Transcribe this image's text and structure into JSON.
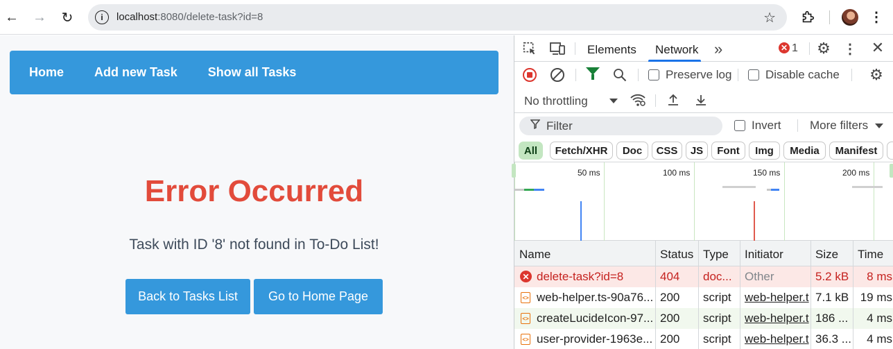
{
  "browser": {
    "url_host": "localhost",
    "url_rest": ":8080/delete-task?id=8",
    "icons": {
      "back": "back-arrow-icon",
      "forward": "forward-arrow-icon",
      "reload": "reload-icon",
      "info": "site-info-icon",
      "bookmark": "star-icon",
      "extensions": "puzzle-icon",
      "menu": "kebab-menu-icon"
    }
  },
  "page": {
    "nav": [
      "Home",
      "Add new Task",
      "Show all Tasks"
    ],
    "error_title": "Error Occurred",
    "error_message": "Task with ID '8' not found in To-Do List!",
    "buttons": {
      "back": "Back to Tasks List",
      "home": "Go to Home Page"
    },
    "colors": {
      "brand": "#3598dc",
      "error": "#e24b3b"
    }
  },
  "devtools": {
    "tabs": [
      "Elements",
      "Network"
    ],
    "active_tab": "Network",
    "more_tabs": "»",
    "error_count": "1",
    "preserve_log": "Preserve log",
    "disable_cache": "Disable cache",
    "throttling": "No throttling",
    "filter_placeholder": "Filter",
    "invert": "Invert",
    "more_filters": "More filters",
    "type_filters": [
      "All",
      "Fetch/XHR",
      "Doc",
      "CSS",
      "JS",
      "Font",
      "Img",
      "Media",
      "Manifest"
    ],
    "active_type_filter": "All",
    "timeline_labels": [
      "50 ms",
      "100 ms",
      "150 ms",
      "200 ms"
    ],
    "columns": [
      "Name",
      "Status",
      "Type",
      "Initiator",
      "Size",
      "Time"
    ],
    "rows": [
      {
        "name": "delete-task?id=8",
        "status": "404",
        "type": "doc...",
        "initiator": "Other",
        "size": "5.2 kB",
        "time": "8 ms",
        "error": true
      },
      {
        "name": "web-helper.ts-90a76...",
        "status": "200",
        "type": "script",
        "initiator": "web-helper.t",
        "size": "7.1 kB",
        "time": "19 ms",
        "error": false
      },
      {
        "name": "createLucideIcon-97...",
        "status": "200",
        "type": "script",
        "initiator": "web-helper.t",
        "size": "186 ...",
        "time": "4 ms",
        "error": false
      },
      {
        "name": "user-provider-1963e...",
        "status": "200",
        "type": "script",
        "initiator": "web-helper.t",
        "size": "36.3 ...",
        "time": "4 ms",
        "error": false
      }
    ]
  }
}
